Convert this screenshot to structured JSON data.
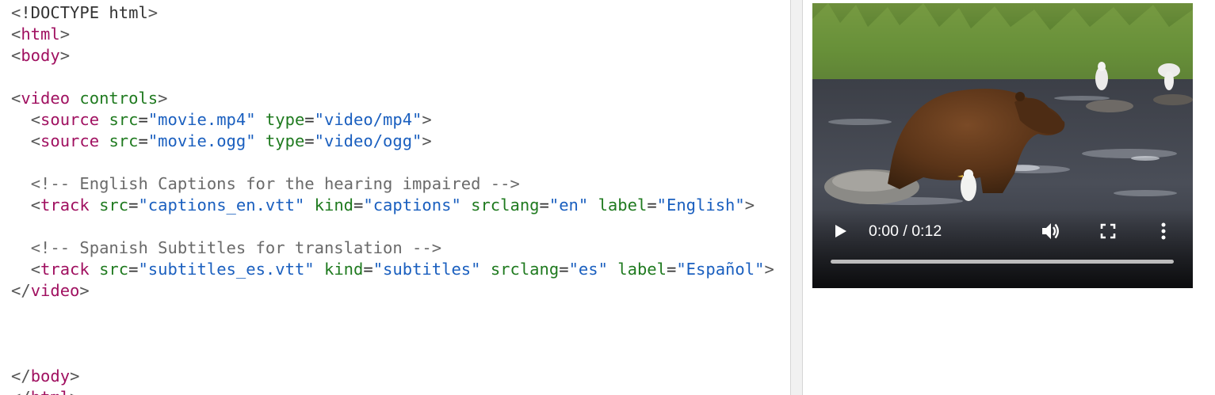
{
  "editor": {
    "lines": [
      [
        {
          "t": "<",
          "c": "bracket"
        },
        {
          "t": "!DOCTYPE html",
          "c": "plain"
        },
        {
          "t": ">",
          "c": "bracket"
        }
      ],
      [
        {
          "t": "<",
          "c": "bracket"
        },
        {
          "t": "html",
          "c": "tag"
        },
        {
          "t": ">",
          "c": "bracket"
        }
      ],
      [
        {
          "t": "<",
          "c": "bracket"
        },
        {
          "t": "body",
          "c": "tag"
        },
        {
          "t": ">",
          "c": "bracket"
        }
      ],
      [],
      [
        {
          "t": "<",
          "c": "bracket"
        },
        {
          "t": "video",
          "c": "tag"
        },
        {
          "t": " ",
          "c": "plain"
        },
        {
          "t": "controls",
          "c": "attr"
        },
        {
          "t": ">",
          "c": "bracket"
        }
      ],
      [
        {
          "t": "  ",
          "c": "plain"
        },
        {
          "t": "<",
          "c": "bracket"
        },
        {
          "t": "source",
          "c": "tag"
        },
        {
          "t": " ",
          "c": "plain"
        },
        {
          "t": "src",
          "c": "attr"
        },
        {
          "t": "=",
          "c": "plain"
        },
        {
          "t": "\"movie.mp4\"",
          "c": "value"
        },
        {
          "t": " ",
          "c": "plain"
        },
        {
          "t": "type",
          "c": "attr"
        },
        {
          "t": "=",
          "c": "plain"
        },
        {
          "t": "\"video/mp4\"",
          "c": "value"
        },
        {
          "t": ">",
          "c": "bracket"
        }
      ],
      [
        {
          "t": "  ",
          "c": "plain"
        },
        {
          "t": "<",
          "c": "bracket"
        },
        {
          "t": "source",
          "c": "tag"
        },
        {
          "t": " ",
          "c": "plain"
        },
        {
          "t": "src",
          "c": "attr"
        },
        {
          "t": "=",
          "c": "plain"
        },
        {
          "t": "\"movie.ogg\"",
          "c": "value"
        },
        {
          "t": " ",
          "c": "plain"
        },
        {
          "t": "type",
          "c": "attr"
        },
        {
          "t": "=",
          "c": "plain"
        },
        {
          "t": "\"video/ogg\"",
          "c": "value"
        },
        {
          "t": ">",
          "c": "bracket"
        }
      ],
      [],
      [
        {
          "t": "  ",
          "c": "plain"
        },
        {
          "t": "<!-- English Captions for the hearing impaired -->",
          "c": "comment"
        }
      ],
      [
        {
          "t": "  ",
          "c": "plain"
        },
        {
          "t": "<",
          "c": "bracket"
        },
        {
          "t": "track",
          "c": "tag"
        },
        {
          "t": " ",
          "c": "plain"
        },
        {
          "t": "src",
          "c": "attr"
        },
        {
          "t": "=",
          "c": "plain"
        },
        {
          "t": "\"captions_en.vtt\"",
          "c": "value"
        },
        {
          "t": " ",
          "c": "plain"
        },
        {
          "t": "kind",
          "c": "attr"
        },
        {
          "t": "=",
          "c": "plain"
        },
        {
          "t": "\"captions\"",
          "c": "value"
        },
        {
          "t": " ",
          "c": "plain"
        },
        {
          "t": "srclang",
          "c": "attr"
        },
        {
          "t": "=",
          "c": "plain"
        },
        {
          "t": "\"en\"",
          "c": "value"
        },
        {
          "t": " ",
          "c": "plain"
        },
        {
          "t": "label",
          "c": "attr"
        },
        {
          "t": "=",
          "c": "plain"
        },
        {
          "t": "\"English\"",
          "c": "value"
        },
        {
          "t": ">",
          "c": "bracket"
        }
      ],
      [],
      [
        {
          "t": "  ",
          "c": "plain"
        },
        {
          "t": "<!-- Spanish Subtitles for translation -->",
          "c": "comment"
        }
      ],
      [
        {
          "t": "  ",
          "c": "plain"
        },
        {
          "t": "<",
          "c": "bracket"
        },
        {
          "t": "track",
          "c": "tag"
        },
        {
          "t": " ",
          "c": "plain"
        },
        {
          "t": "src",
          "c": "attr"
        },
        {
          "t": "=",
          "c": "plain"
        },
        {
          "t": "\"subtitles_es.vtt\"",
          "c": "value"
        },
        {
          "t": " ",
          "c": "plain"
        },
        {
          "t": "kind",
          "c": "attr"
        },
        {
          "t": "=",
          "c": "plain"
        },
        {
          "t": "\"subtitles\"",
          "c": "value"
        },
        {
          "t": " ",
          "c": "plain"
        },
        {
          "t": "srclang",
          "c": "attr"
        },
        {
          "t": "=",
          "c": "plain"
        },
        {
          "t": "\"es\"",
          "c": "value"
        },
        {
          "t": " ",
          "c": "plain"
        },
        {
          "t": "label",
          "c": "attr"
        },
        {
          "t": "=",
          "c": "plain"
        },
        {
          "t": "\"Español\"",
          "c": "value"
        },
        {
          "t": ">",
          "c": "bracket"
        }
      ],
      [
        {
          "t": "<",
          "c": "bracket"
        },
        {
          "t": "/",
          "c": "bracket"
        },
        {
          "t": "video",
          "c": "tag"
        },
        {
          "t": ">",
          "c": "bracket"
        }
      ],
      [],
      [],
      [],
      [
        {
          "t": "<",
          "c": "bracket"
        },
        {
          "t": "/",
          "c": "bracket"
        },
        {
          "t": "body",
          "c": "tag"
        },
        {
          "t": ">",
          "c": "bracket"
        }
      ],
      [
        {
          "t": "<",
          "c": "bracket"
        },
        {
          "t": "/",
          "c": "bracket"
        },
        {
          "t": "html",
          "c": "tag"
        },
        {
          "t": ">",
          "c": "bracket"
        }
      ]
    ]
  },
  "video_player": {
    "time_display": "0:00 / 0:12",
    "progress_fraction": 0,
    "icons": {
      "play": "play-icon",
      "volume": "volume-icon",
      "fullscreen": "fullscreen-icon",
      "more": "more-options-icon"
    }
  },
  "colors": {
    "tag": "#a01060",
    "attribute": "#1f7a1f",
    "value": "#1a5fbf",
    "comment": "#6a6a6a"
  }
}
